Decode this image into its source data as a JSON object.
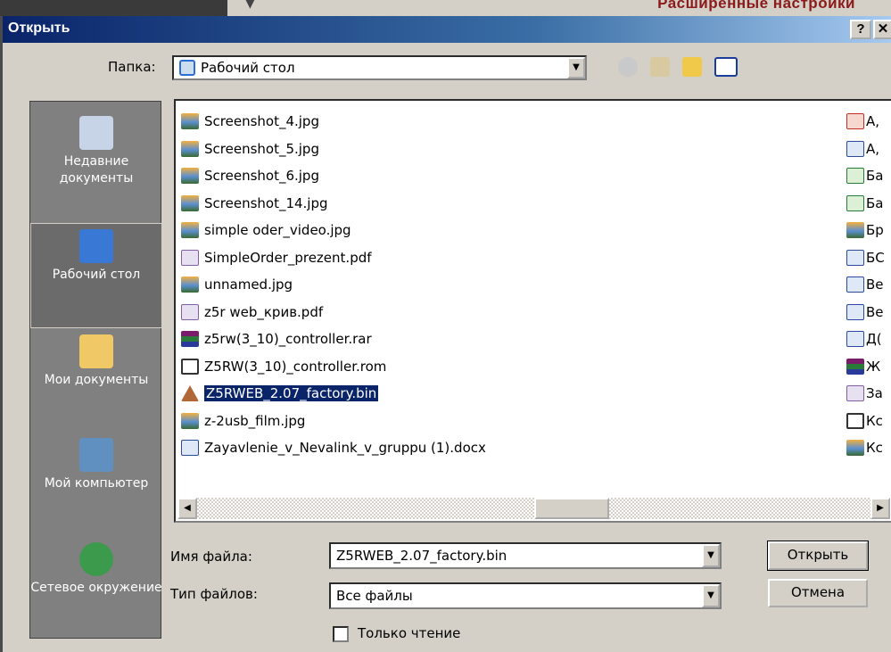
{
  "background": {
    "right_title": "Расширенные настройки"
  },
  "window": {
    "title": "Открыть",
    "help_button": "?",
    "close_button": "✕"
  },
  "folder": {
    "label": "Папка:",
    "value": "Рабочий стол"
  },
  "places": [
    {
      "label": "Недавние документы",
      "icon": "recent-documents-icon"
    },
    {
      "label": "Рабочий стол",
      "icon": "desktop-icon",
      "selected": true
    },
    {
      "label": "Мои документы",
      "icon": "my-documents-icon"
    },
    {
      "label": "Мой компьютер",
      "icon": "my-computer-icon"
    },
    {
      "label": "Сетевое окружение",
      "icon": "network-icon"
    }
  ],
  "files": [
    {
      "name": "Screenshot_4.jpg",
      "type": "jpg"
    },
    {
      "name": "Screenshot_5.jpg",
      "type": "jpg"
    },
    {
      "name": "Screenshot_6.jpg",
      "type": "jpg"
    },
    {
      "name": "Screenshot_14.jpg",
      "type": "jpg"
    },
    {
      "name": "simple oder_video.jpg",
      "type": "jpg"
    },
    {
      "name": "SimpleOrder_prezent.pdf",
      "type": "pdf"
    },
    {
      "name": "unnamed.jpg",
      "type": "jpg"
    },
    {
      "name": "z5r web_крив.pdf",
      "type": "pdf"
    },
    {
      "name": "z5rw(3_10)_controller.rar",
      "type": "rar"
    },
    {
      "name": "Z5RW(3_10)_controller.rom",
      "type": "rom"
    },
    {
      "name": "Z5RWEB_2.07_factory.bin",
      "type": "bin",
      "selected": true
    },
    {
      "name": "z-2usb_film.jpg",
      "type": "jpg"
    },
    {
      "name": "Zayavlenie_v_Nevalink_v_gruppu (1).docx",
      "type": "doc"
    }
  ],
  "files_col2": [
    {
      "name": "А,",
      "type": "ppt"
    },
    {
      "name": "А,",
      "type": "doc"
    },
    {
      "name": "Ба",
      "type": "xls"
    },
    {
      "name": "Ба",
      "type": "xls"
    },
    {
      "name": "Бр",
      "type": "jpg"
    },
    {
      "name": "БС",
      "type": "doc"
    },
    {
      "name": "Ве",
      "type": "doc"
    },
    {
      "name": "Ве",
      "type": "doc"
    },
    {
      "name": "Д(",
      "type": "doc"
    },
    {
      "name": "Ж",
      "type": "rar"
    },
    {
      "name": "За",
      "type": "pdf"
    },
    {
      "name": "Кс",
      "type": "rom"
    },
    {
      "name": "Кс",
      "type": "jpg"
    }
  ],
  "filename": {
    "label": "Имя файла:",
    "value": "Z5RWEB_2.07_factory.bin"
  },
  "filetype": {
    "label": "Тип файлов:",
    "value": "Все файлы"
  },
  "buttons": {
    "open": "Открыть",
    "cancel": "Отмена"
  },
  "readonly": {
    "label": "Только чтение",
    "checked": false
  }
}
